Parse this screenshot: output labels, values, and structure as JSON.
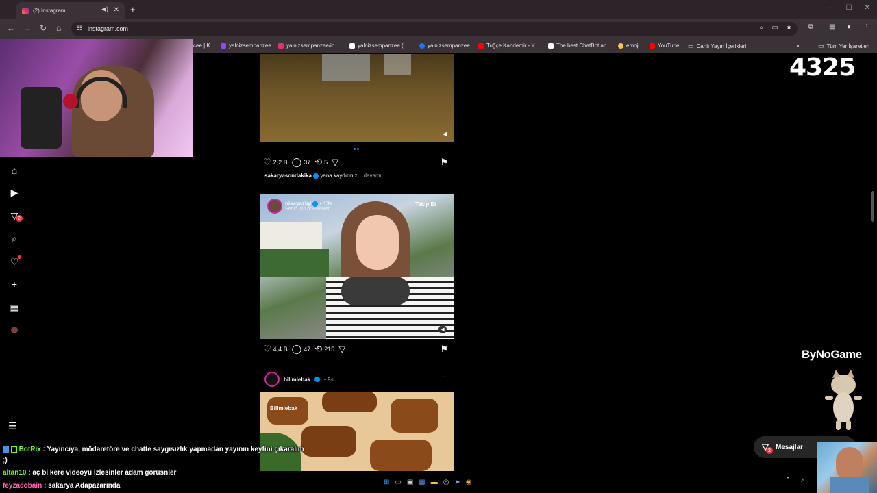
{
  "browser": {
    "tab_title": "(2) Instagram",
    "url": "instagram.com",
    "bookmarks": [
      {
        "label": "cee | K...",
        "color": "#888888"
      },
      {
        "label": "yalnizsempanzee",
        "color": "#9146ff"
      },
      {
        "label": "yalnizsempanzee/in...",
        "color": "#e1306c"
      },
      {
        "label": "yalnizsempanzee (...",
        "color": "#ffffff"
      },
      {
        "label": "yalnizsempanzee",
        "color": "#1877f2"
      },
      {
        "label": "Tuğçe Kandemir - Y...",
        "color": "#ff0000"
      },
      {
        "label": "The best ChatBot an...",
        "color": "#ffffff"
      },
      {
        "label": "emoji",
        "color": "#f7c948"
      },
      {
        "label": "YouTube",
        "color": "#ff0000"
      },
      {
        "label": "Canlı Yayın İçerikleri",
        "color": "#cccccc"
      }
    ],
    "all_bookmarks": "Tüm Yer İşaretleri"
  },
  "overlay": {
    "viewer_count": "4325",
    "brand": "ByNoGame"
  },
  "posts": [
    {
      "likes": "2,2 B",
      "comments": "37",
      "reposts": "5",
      "caption_user": "sakaryasondakika",
      "caption_text": "yana kaydırınız...",
      "caption_more": "devamı"
    },
    {
      "user": "nisayaziqi",
      "time": "• 13s",
      "sub": "Senin için önerilenler",
      "follow": "Takip Et",
      "likes": "4,4 B",
      "comments": "47",
      "reposts": "215"
    },
    {
      "user": "bilimlebak",
      "time": "• 9s",
      "watermark": "Bilimlebak"
    }
  ],
  "messages": {
    "label": "Mesajlar",
    "badge": "2"
  },
  "sidebar": {
    "notification_badge": "2"
  },
  "chat": [
    {
      "user": "BotRix",
      "color": "#7CFC00",
      "text": ": Yayıncıya, mödaretöre ve chatte saygısızlık yapmadan yayının keyfini çıkaralım"
    },
    {
      "user": "",
      "color": "#ffffff",
      "text": ";)"
    },
    {
      "user": "altan10",
      "color": "#7CFC00",
      "text": ": aç bi kere videoyu izlesinler adam görüsnler"
    },
    {
      "user": "feyzacobain",
      "color": "#ff69b4",
      "text": ": sakarya Adapazarında"
    }
  ]
}
